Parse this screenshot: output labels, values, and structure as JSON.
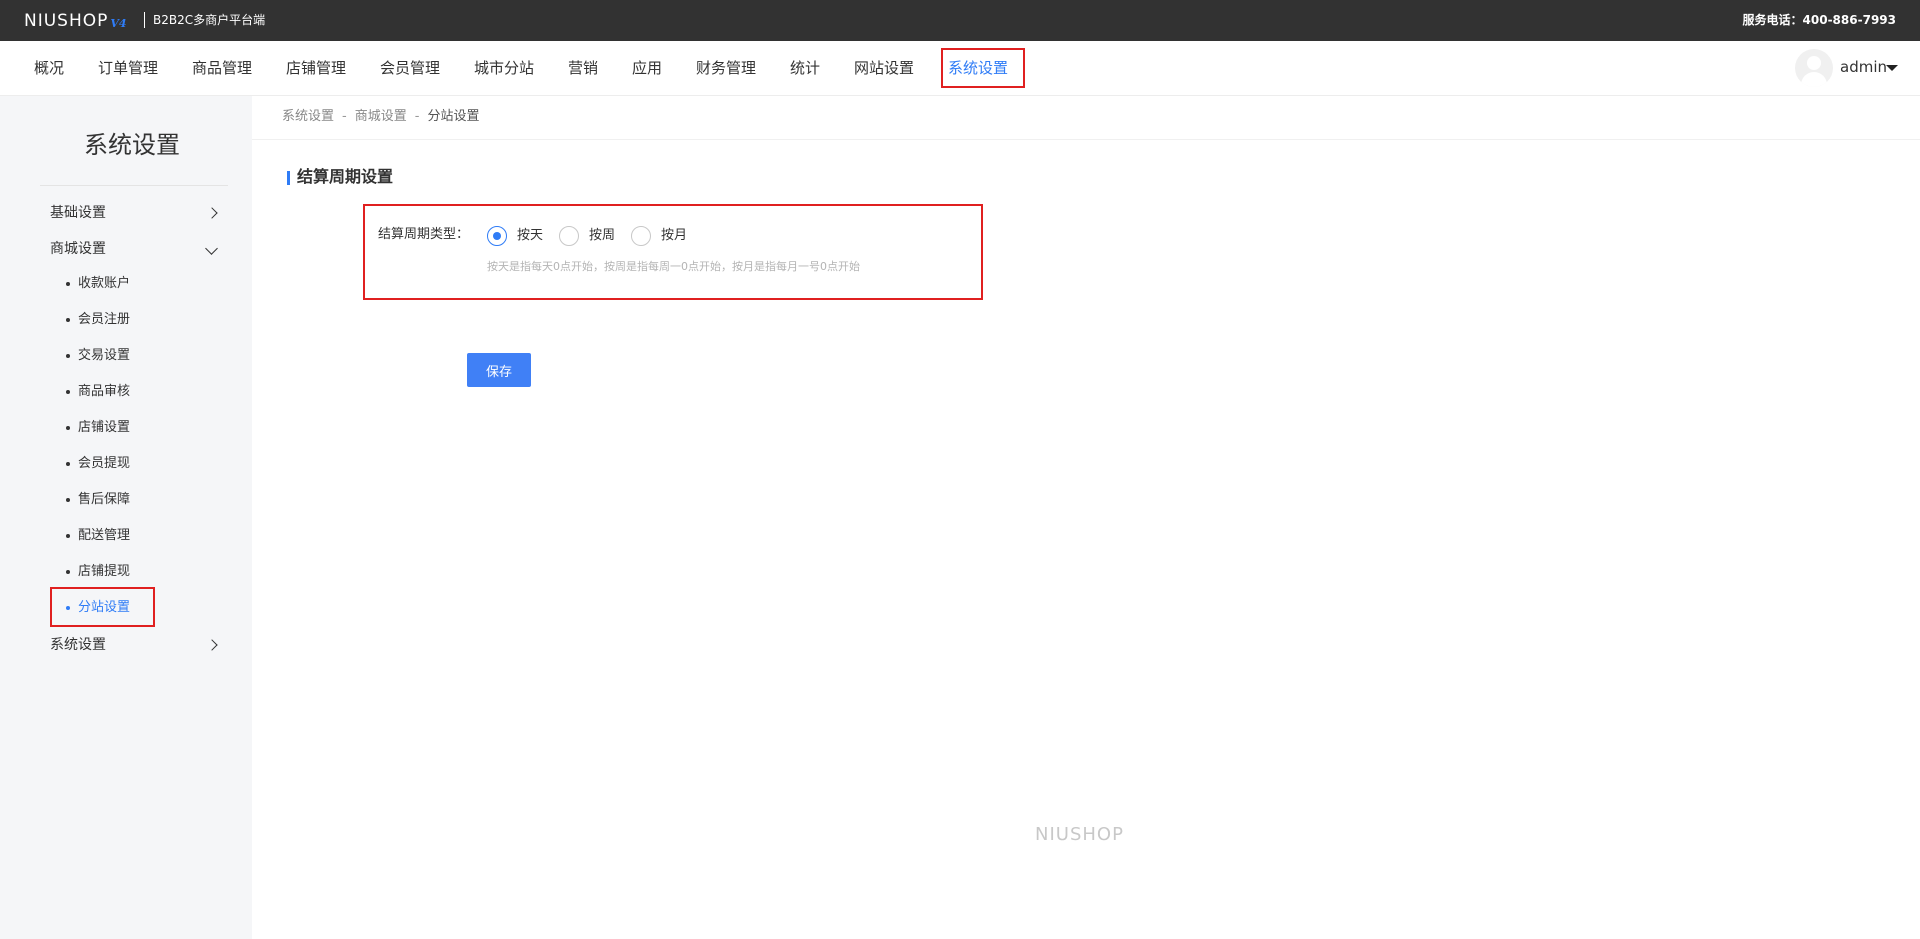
{
  "topbar": {
    "logo": "NIUSHOP",
    "logo_version": "V4",
    "subtitle": "B2B2C多商户平台端",
    "hotline": "服务电话：400-886-7993"
  },
  "mainnav": {
    "items": [
      "概况",
      "订单管理",
      "商品管理",
      "店铺管理",
      "会员管理",
      "城市分站",
      "营销",
      "应用",
      "财务管理",
      "统计",
      "网站设置",
      "系统设置"
    ],
    "active": "系统设置",
    "user": "admin"
  },
  "sidebar": {
    "title": "系统设置",
    "groups": {
      "basic": "基础设置",
      "mall": "商城设置",
      "system": "系统设置"
    },
    "mall_items": [
      "收款账户",
      "会员注册",
      "交易设置",
      "商品审核",
      "店铺设置",
      "会员提现",
      "售后保障",
      "配送管理",
      "店铺提现",
      "分站设置"
    ],
    "active_item": "分站设置"
  },
  "breadcrumb": {
    "items": [
      "系统设置",
      "商城设置",
      "分站设置"
    ],
    "separator": "-"
  },
  "section": {
    "title": "结算周期设置"
  },
  "form": {
    "label": "结算周期类型：",
    "options": [
      "按天",
      "按周",
      "按月"
    ],
    "selected": "按天",
    "hint": "按天是指每天0点开始，按周是指每周一0点开始，按月是指每月一号0点开始",
    "save_label": "保存"
  },
  "footer": {
    "logo": "NIUSHOP"
  },
  "colors": {
    "accent": "#2f7cf6",
    "topbar": "#323232",
    "highlight": "#e02020",
    "sidebar_bg": "#f5f6f8"
  }
}
